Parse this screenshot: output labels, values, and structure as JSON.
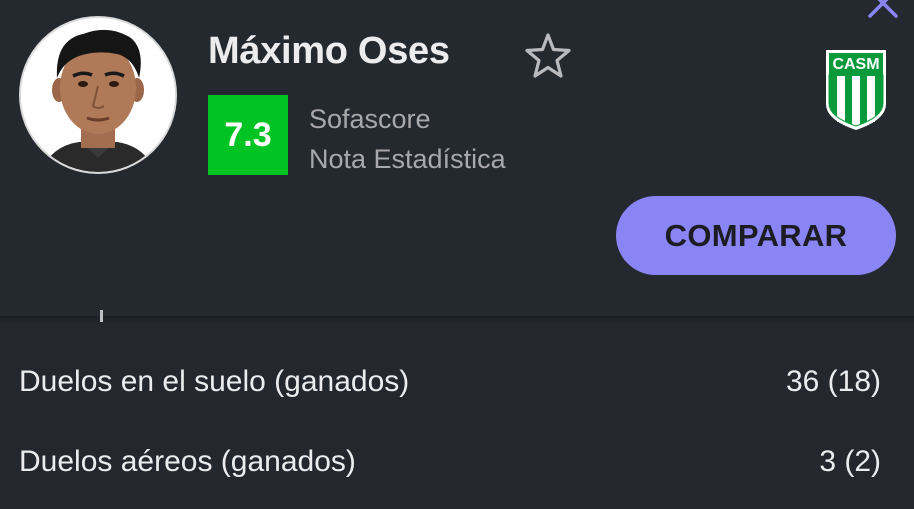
{
  "player": {
    "name": "Máximo Oses",
    "rating": "7.3",
    "rating_source": "Sofascore",
    "rating_type": "Nota Estadística",
    "team_crest_text": "CASM"
  },
  "actions": {
    "compare_label": "COMPARAR"
  },
  "stats": [
    {
      "label": "Duelos en el suelo (ganados)",
      "value": "36 (18)"
    },
    {
      "label": "Duelos aéreos (ganados)",
      "value": "3 (2)"
    }
  ],
  "colors": {
    "background": "#24272e",
    "rating_green": "#00c424",
    "compare_button": "#8a85f5",
    "close_icon": "#8a85f5",
    "crest_green": "#0a9a3c"
  },
  "icons": {
    "close": "close-icon",
    "favorite": "star-outline-icon",
    "crest": "team-crest-icon"
  }
}
